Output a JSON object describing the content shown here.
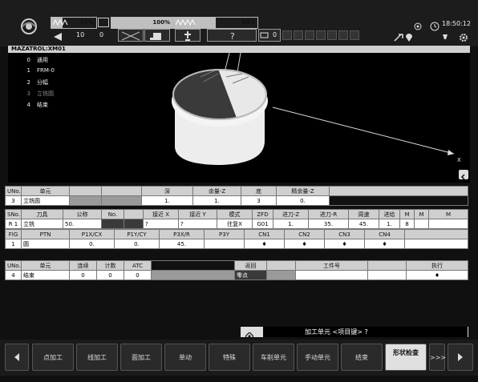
{
  "statusbar": {
    "gauge1_pct": "25%",
    "gauge2_pct": "100%",
    "gauge3_pct": "50%",
    "gauge1_level": 0.25,
    "gauge2_level": 1.0,
    "gauge3_level": 0.5,
    "num1": "10",
    "num2": "0",
    "counter": "0",
    "clock": "18:50:12"
  },
  "program_title": "MAZATROL:XM01",
  "menu": [
    {
      "n": "0",
      "label": "通用"
    },
    {
      "n": "1",
      "label": "FRM-0"
    },
    {
      "n": "2",
      "label": "分幅"
    },
    {
      "n": "3",
      "label": "立铣圆"
    },
    {
      "n": "4",
      "label": "结束"
    }
  ],
  "view_axis_label": "X",
  "unit_table": {
    "headers": [
      "UNo.",
      "单元",
      "",
      "",
      "深",
      "余量-Z",
      "底",
      "精余量-Z"
    ],
    "row": [
      "3",
      "立铣圆",
      "",
      "",
      "1.",
      "1.",
      "3",
      "0."
    ]
  },
  "tool_table": {
    "headers": [
      "SNo.",
      "刀具",
      "公称",
      "No.",
      "",
      "接近 X",
      "接近 Y",
      "模式",
      "ZFD",
      "进刀-Z",
      "进刀-R",
      "周速",
      "进给",
      "M",
      "M",
      "M"
    ],
    "row": [
      "R 1",
      "立铣",
      "50.",
      "",
      "",
      "?",
      "?",
      "往复X",
      "G01",
      "1.",
      "35.",
      "45.",
      "1.",
      "8",
      "",
      ""
    ]
  },
  "fig_table": {
    "headers": [
      "FIG",
      "PTN",
      "P1X/CX",
      "P1Y/CY",
      "P3X/R",
      "P3Y",
      "CN1",
      "CN2",
      "CN3",
      "CN4"
    ],
    "row": [
      "1",
      "圆",
      "0.",
      "0.",
      "45.",
      "",
      "♦",
      "♦",
      "♦",
      "♦"
    ]
  },
  "end_table": {
    "headers": [
      "UNo.",
      "单元",
      "连续",
      "计数",
      "ATC",
      "",
      "返回",
      "",
      "工件号",
      "",
      "执行"
    ],
    "row": [
      "4",
      "结束",
      "0",
      "0",
      "0",
      "",
      "零点",
      "",
      "",
      "",
      "♦"
    ]
  },
  "message": "加工单元 <项目键> ?",
  "fkeys": [
    "点加工",
    "线加工",
    "面加工",
    "单动",
    "特殊",
    "车削单元",
    "手动单元",
    "结束",
    "形状检查",
    ">>>"
  ]
}
